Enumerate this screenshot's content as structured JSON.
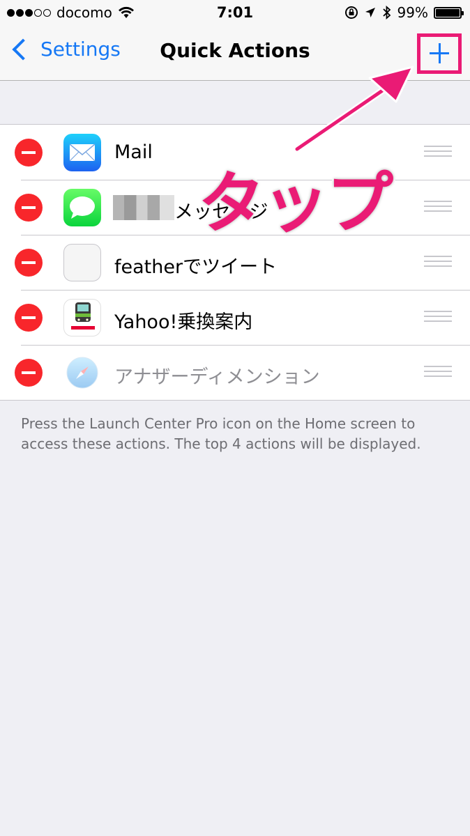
{
  "status_bar": {
    "carrier": "docomo",
    "time": "7:01",
    "battery_text": "99%",
    "battery_level": 0.99,
    "signal_filled": 3,
    "signal_total": 5
  },
  "nav": {
    "back_label": "Settings",
    "title": "Quick Actions"
  },
  "actions": [
    {
      "label": "Mail",
      "icon": "mail-icon",
      "dim": false
    },
    {
      "label": "メッセージ",
      "icon": "messages-icon",
      "dim": false
    },
    {
      "label": "featherでツイート",
      "icon": "feather-icon",
      "dim": false
    },
    {
      "label": "Yahoo!乗換案内",
      "icon": "yahoo-transit-icon",
      "dim": false
    },
    {
      "label": "アナザーディメンション",
      "icon": "safari-icon",
      "dim": true
    }
  ],
  "footer": {
    "text": "Press the Launch Center Pro icon on the Home screen to access these actions. The top 4 actions will be displayed."
  },
  "annotation": {
    "text": "タップ"
  },
  "colors": {
    "accent": "#1678f5",
    "delete": "#f8262b",
    "annotation": "#ea1b75",
    "background": "#efeff4"
  }
}
